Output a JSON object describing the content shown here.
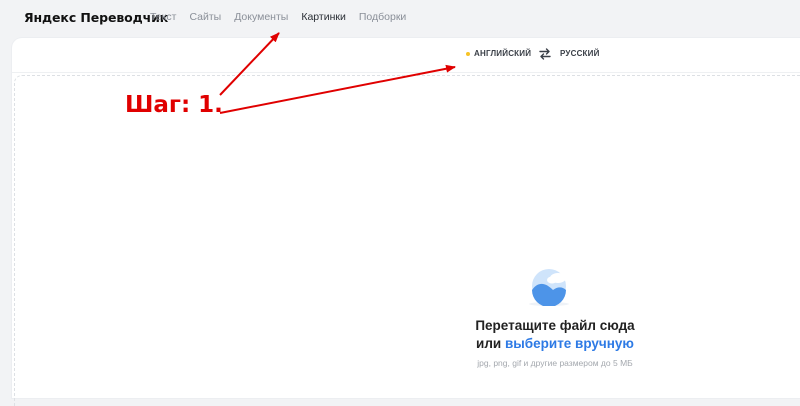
{
  "brand": "Яндекс Переводчик",
  "nav": [
    {
      "label": "Текст",
      "active": false
    },
    {
      "label": "Сайты",
      "active": false
    },
    {
      "label": "Документы",
      "active": false
    },
    {
      "label": "Картинки",
      "active": true
    },
    {
      "label": "Подборки",
      "active": false
    }
  ],
  "languages": {
    "source": "АНГЛИЙСКИЙ",
    "target": "РУССКИЙ",
    "swap_icon": "swap-arrows-icon"
  },
  "dropzone": {
    "title": "Перетащите файл сюда",
    "line2_prefix": "или ",
    "pick_link": "выберите вручную",
    "hint": "jpg, png, gif и другие размером до 5 МБ",
    "icon": "image-icon"
  },
  "annotation": {
    "text": "Шаг: 1."
  },
  "colors": {
    "accent_link": "#2d7ae5",
    "annotation": "#e00000",
    "source_dot": "#f7c325"
  }
}
